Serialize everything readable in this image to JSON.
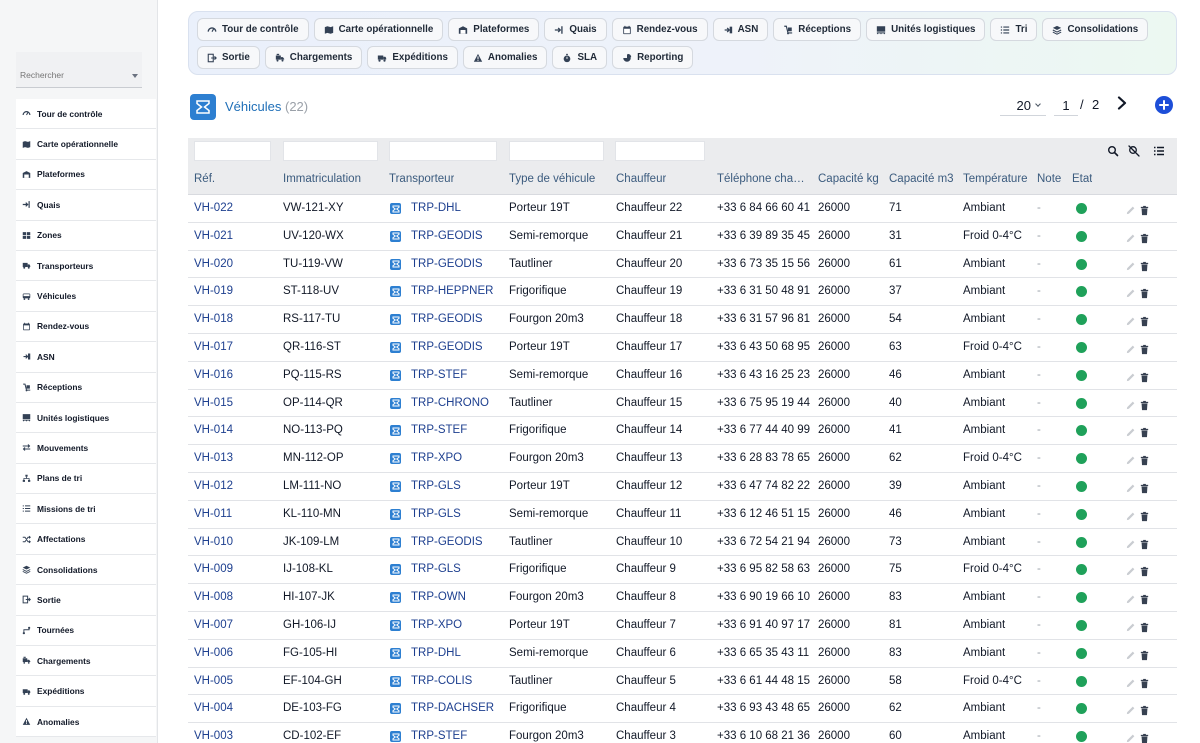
{
  "sidebar": {
    "search_placeholder": "Rechercher",
    "items": [
      {
        "label": "Tour de contrôle",
        "icon": "gauge-icon"
      },
      {
        "label": "Carte opérationnelle",
        "icon": "map-icon"
      },
      {
        "label": "Plateformes",
        "icon": "warehouse-icon"
      },
      {
        "label": "Quais",
        "icon": "dock-icon"
      },
      {
        "label": "Zones",
        "icon": "grid-icon"
      },
      {
        "label": "Transporteurs",
        "icon": "truck-icon"
      },
      {
        "label": "Véhicules",
        "icon": "bus-icon"
      },
      {
        "label": "Rendez-vous",
        "icon": "calendar-icon"
      },
      {
        "label": "ASN",
        "icon": "asn-icon"
      },
      {
        "label": "Réceptions",
        "icon": "dolly-icon"
      },
      {
        "label": "Unités logistiques",
        "icon": "pallet-icon"
      },
      {
        "label": "Mouvements",
        "icon": "arrows-icon"
      },
      {
        "label": "Plans de tri",
        "icon": "sitemap-icon"
      },
      {
        "label": "Missions de tri",
        "icon": "list-icon"
      },
      {
        "label": "Affectations",
        "icon": "shuffle-icon"
      },
      {
        "label": "Consolidations",
        "icon": "layers-icon"
      },
      {
        "label": "Sortie",
        "icon": "exit-icon"
      },
      {
        "label": "Tournées",
        "icon": "route-icon"
      },
      {
        "label": "Chargements",
        "icon": "loading-truck-icon"
      },
      {
        "label": "Expéditions",
        "icon": "shipping-icon"
      },
      {
        "label": "Anomalies",
        "icon": "warning-icon"
      }
    ]
  },
  "toolbar": {
    "row1": [
      {
        "label": "Tour de contrôle",
        "icon": "gauge-icon"
      },
      {
        "label": "Carte opérationnelle",
        "icon": "map-icon"
      },
      {
        "label": "Plateformes",
        "icon": "warehouse-icon"
      },
      {
        "label": "Quais",
        "icon": "dock-icon"
      },
      {
        "label": "Rendez-vous",
        "icon": "calendar-icon"
      },
      {
        "label": "ASN",
        "icon": "asn-icon"
      },
      {
        "label": "Réceptions",
        "icon": "dolly-icon"
      },
      {
        "label": "Unités logistiques",
        "icon": "pallet-icon"
      },
      {
        "label": "Tri",
        "icon": "list-icon"
      },
      {
        "label": "Consolidations",
        "icon": "layers-icon"
      }
    ],
    "row2": [
      {
        "label": "Sortie",
        "icon": "exit-icon"
      },
      {
        "label": "Chargements",
        "icon": "loading-truck-icon"
      },
      {
        "label": "Expéditions",
        "icon": "shipping-icon"
      },
      {
        "label": "Anomalies",
        "icon": "warning-icon"
      },
      {
        "label": "SLA",
        "icon": "stopwatch-icon"
      },
      {
        "label": "Reporting",
        "icon": "pie-chart-icon"
      }
    ]
  },
  "header": {
    "title": "Véhicules",
    "count": "(22)"
  },
  "pager": {
    "page_size": "20",
    "current_page": "1",
    "separator": "/",
    "total_pages": "2"
  },
  "colors": {
    "accent": "#1d4ed8",
    "link": "#1d3f8f",
    "title": "#1f6fb8",
    "status_ok": "#1fa15a",
    "logo_bg": "#2d7fd1"
  },
  "table": {
    "columns": [
      "Réf.",
      "Immatriculation",
      "Transporteur",
      "Type de véhicule",
      "Chauffeur",
      "Téléphone cha…",
      "Capacité kg",
      "Capacité m3",
      "Température",
      "Note",
      "État"
    ],
    "rows": [
      {
        "ref": "VH-022",
        "immat": "VW-121-XY",
        "trp": "TRP-DHL",
        "type": "Porteur 19T",
        "chauffeur": "Chauffeur 22",
        "tel": "+33 6 84 66 60 41",
        "kg": "26000",
        "m3": "71",
        "temp": "Ambiant",
        "note": "-"
      },
      {
        "ref": "VH-021",
        "immat": "UV-120-WX",
        "trp": "TRP-GEODIS",
        "type": "Semi-remorque",
        "chauffeur": "Chauffeur 21",
        "tel": "+33 6 39 89 35 45",
        "kg": "26000",
        "m3": "31",
        "temp": "Froid 0-4°C",
        "note": "-"
      },
      {
        "ref": "VH-020",
        "immat": "TU-119-VW",
        "trp": "TRP-GEODIS",
        "type": "Tautliner",
        "chauffeur": "Chauffeur 20",
        "tel": "+33 6 73 35 15 56",
        "kg": "26000",
        "m3": "61",
        "temp": "Ambiant",
        "note": "-"
      },
      {
        "ref": "VH-019",
        "immat": "ST-118-UV",
        "trp": "TRP-HEPPNER",
        "type": "Frigorifique",
        "chauffeur": "Chauffeur 19",
        "tel": "+33 6 31 50 48 91",
        "kg": "26000",
        "m3": "37",
        "temp": "Ambiant",
        "note": "-"
      },
      {
        "ref": "VH-018",
        "immat": "RS-117-TU",
        "trp": "TRP-GEODIS",
        "type": "Fourgon 20m3",
        "chauffeur": "Chauffeur 18",
        "tel": "+33 6 31 57 96 81",
        "kg": "26000",
        "m3": "54",
        "temp": "Ambiant",
        "note": "-"
      },
      {
        "ref": "VH-017",
        "immat": "QR-116-ST",
        "trp": "TRP-GEODIS",
        "type": "Porteur 19T",
        "chauffeur": "Chauffeur 17",
        "tel": "+33 6 43 50 68 95",
        "kg": "26000",
        "m3": "63",
        "temp": "Froid 0-4°C",
        "note": "-"
      },
      {
        "ref": "VH-016",
        "immat": "PQ-115-RS",
        "trp": "TRP-STEF",
        "type": "Semi-remorque",
        "chauffeur": "Chauffeur 16",
        "tel": "+33 6 43 16 25 23",
        "kg": "26000",
        "m3": "46",
        "temp": "Ambiant",
        "note": "-"
      },
      {
        "ref": "VH-015",
        "immat": "OP-114-QR",
        "trp": "TRP-CHRONO",
        "type": "Tautliner",
        "chauffeur": "Chauffeur 15",
        "tel": "+33 6 75 95 19 44",
        "kg": "26000",
        "m3": "40",
        "temp": "Ambiant",
        "note": "-"
      },
      {
        "ref": "VH-014",
        "immat": "NO-113-PQ",
        "trp": "TRP-STEF",
        "type": "Frigorifique",
        "chauffeur": "Chauffeur 14",
        "tel": "+33 6 77 44 40 99",
        "kg": "26000",
        "m3": "41",
        "temp": "Ambiant",
        "note": "-"
      },
      {
        "ref": "VH-013",
        "immat": "MN-112-OP",
        "trp": "TRP-XPO",
        "type": "Fourgon 20m3",
        "chauffeur": "Chauffeur 13",
        "tel": "+33 6 28 83 78 65",
        "kg": "26000",
        "m3": "62",
        "temp": "Froid 0-4°C",
        "note": "-"
      },
      {
        "ref": "VH-012",
        "immat": "LM-111-NO",
        "trp": "TRP-GLS",
        "type": "Porteur 19T",
        "chauffeur": "Chauffeur 12",
        "tel": "+33 6 47 74 82 22",
        "kg": "26000",
        "m3": "39",
        "temp": "Ambiant",
        "note": "-"
      },
      {
        "ref": "VH-011",
        "immat": "KL-110-MN",
        "trp": "TRP-GLS",
        "type": "Semi-remorque",
        "chauffeur": "Chauffeur 11",
        "tel": "+33 6 12 46 51 15",
        "kg": "26000",
        "m3": "46",
        "temp": "Ambiant",
        "note": "-"
      },
      {
        "ref": "VH-010",
        "immat": "JK-109-LM",
        "trp": "TRP-GEODIS",
        "type": "Tautliner",
        "chauffeur": "Chauffeur 10",
        "tel": "+33 6 72 54 21 94",
        "kg": "26000",
        "m3": "73",
        "temp": "Ambiant",
        "note": "-"
      },
      {
        "ref": "VH-009",
        "immat": "IJ-108-KL",
        "trp": "TRP-GLS",
        "type": "Frigorifique",
        "chauffeur": "Chauffeur 9",
        "tel": "+33 6 95 82 58 63",
        "kg": "26000",
        "m3": "75",
        "temp": "Froid 0-4°C",
        "note": "-"
      },
      {
        "ref": "VH-008",
        "immat": "HI-107-JK",
        "trp": "TRP-OWN",
        "type": "Fourgon 20m3",
        "chauffeur": "Chauffeur 8",
        "tel": "+33 6 90 19 66 10",
        "kg": "26000",
        "m3": "83",
        "temp": "Ambiant",
        "note": "-"
      },
      {
        "ref": "VH-007",
        "immat": "GH-106-IJ",
        "trp": "TRP-XPO",
        "type": "Porteur 19T",
        "chauffeur": "Chauffeur 7",
        "tel": "+33 6 91 40 97 17",
        "kg": "26000",
        "m3": "81",
        "temp": "Ambiant",
        "note": "-"
      },
      {
        "ref": "VH-006",
        "immat": "FG-105-HI",
        "trp": "TRP-DHL",
        "type": "Semi-remorque",
        "chauffeur": "Chauffeur 6",
        "tel": "+33 6 65 35 43 11",
        "kg": "26000",
        "m3": "83",
        "temp": "Ambiant",
        "note": "-"
      },
      {
        "ref": "VH-005",
        "immat": "EF-104-GH",
        "trp": "TRP-COLIS",
        "type": "Tautliner",
        "chauffeur": "Chauffeur 5",
        "tel": "+33 6 61 44 48 15",
        "kg": "26000",
        "m3": "58",
        "temp": "Froid 0-4°C",
        "note": "-"
      },
      {
        "ref": "VH-004",
        "immat": "DE-103-FG",
        "trp": "TRP-DACHSER",
        "type": "Frigorifique",
        "chauffeur": "Chauffeur 4",
        "tel": "+33 6 93 43 48 65",
        "kg": "26000",
        "m3": "62",
        "temp": "Ambiant",
        "note": "-"
      },
      {
        "ref": "VH-003",
        "immat": "CD-102-EF",
        "trp": "TRP-STEF",
        "type": "Fourgon 20m3",
        "chauffeur": "Chauffeur 3",
        "tel": "+33 6 10 68 21 36",
        "kg": "26000",
        "m3": "60",
        "temp": "Ambiant",
        "note": "-"
      }
    ]
  }
}
